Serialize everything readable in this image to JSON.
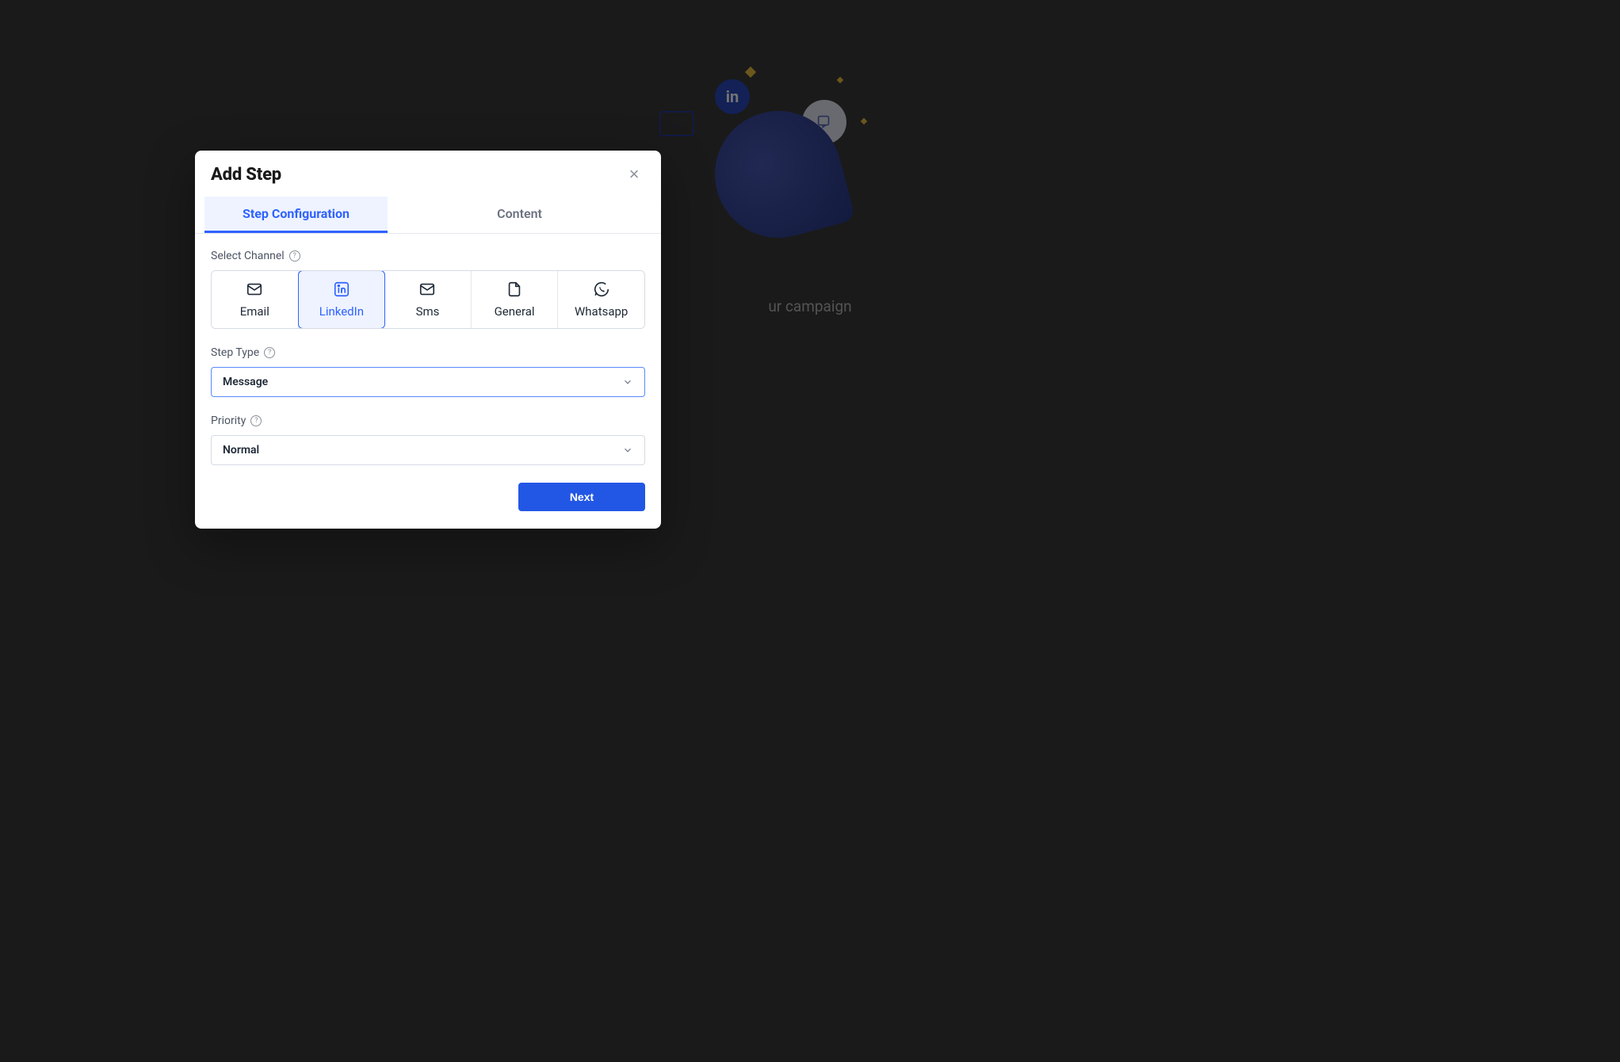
{
  "background": {
    "caption_fragment": "ur campaign"
  },
  "modal": {
    "title": "Add Step",
    "tabs": {
      "config": "Step Configuration",
      "content": "Content",
      "active": "config"
    },
    "select_channel": {
      "label": "Select Channel",
      "options": {
        "email": {
          "label": "Email",
          "icon": "mail-icon"
        },
        "linkedin": {
          "label": "LinkedIn",
          "icon": "linkedin-icon"
        },
        "sms": {
          "label": "Sms",
          "icon": "sms-icon"
        },
        "general": {
          "label": "General",
          "icon": "file-icon"
        },
        "whatsapp": {
          "label": "Whatsapp",
          "icon": "whatsapp-icon"
        }
      },
      "selected": "linkedin"
    },
    "step_type": {
      "label": "Step Type",
      "value": "Message"
    },
    "priority": {
      "label": "Priority",
      "value": "Normal"
    },
    "footer": {
      "next": "Next"
    }
  }
}
